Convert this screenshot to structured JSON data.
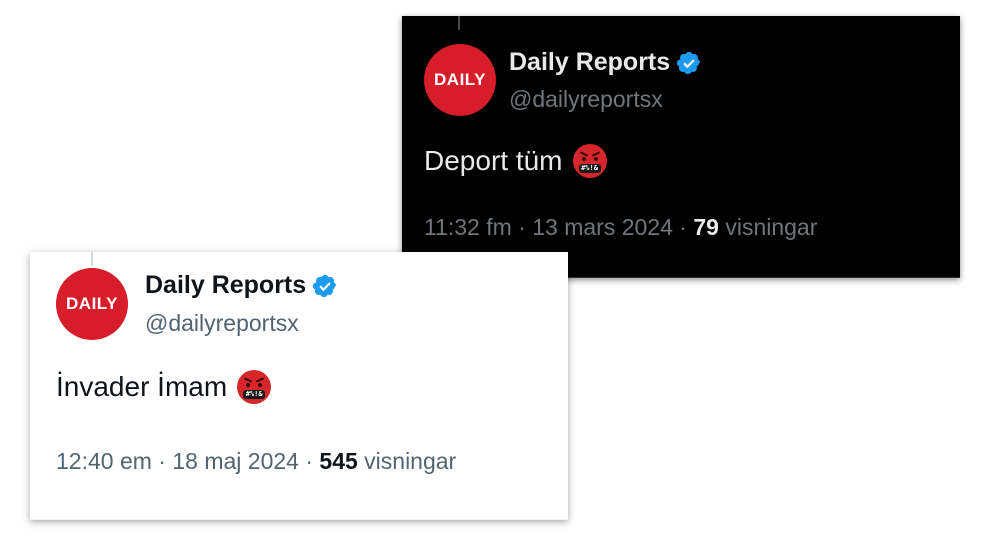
{
  "tweets": [
    {
      "theme": "dark",
      "avatar_text": "DAILY",
      "display_name": "Daily Reports",
      "handle": "@dailyreportsx",
      "text": "Deport tüm",
      "emoji_symbols": "#%!&",
      "time": "11:32 fm",
      "date": "13 mars 2024",
      "views_count": "79",
      "views_label": "visningar",
      "separator": "·"
    },
    {
      "theme": "light",
      "avatar_text": "DAILY",
      "display_name": "Daily Reports",
      "handle": "@dailyreportsx",
      "text": "İnvader İmam",
      "emoji_symbols": "#%!&",
      "time": "12:40 em",
      "date": "18 maj 2024",
      "views_count": "545",
      "views_label": "visningar",
      "separator": "·"
    }
  ],
  "colors": {
    "verified_badge": "#1d9bf0",
    "avatar_brand": "#d71c2a",
    "emoji_face": "#d7262b"
  },
  "icons": {
    "verified": "verified-badge-icon",
    "emoji": "face-with-symbols-on-mouth-emoji"
  }
}
